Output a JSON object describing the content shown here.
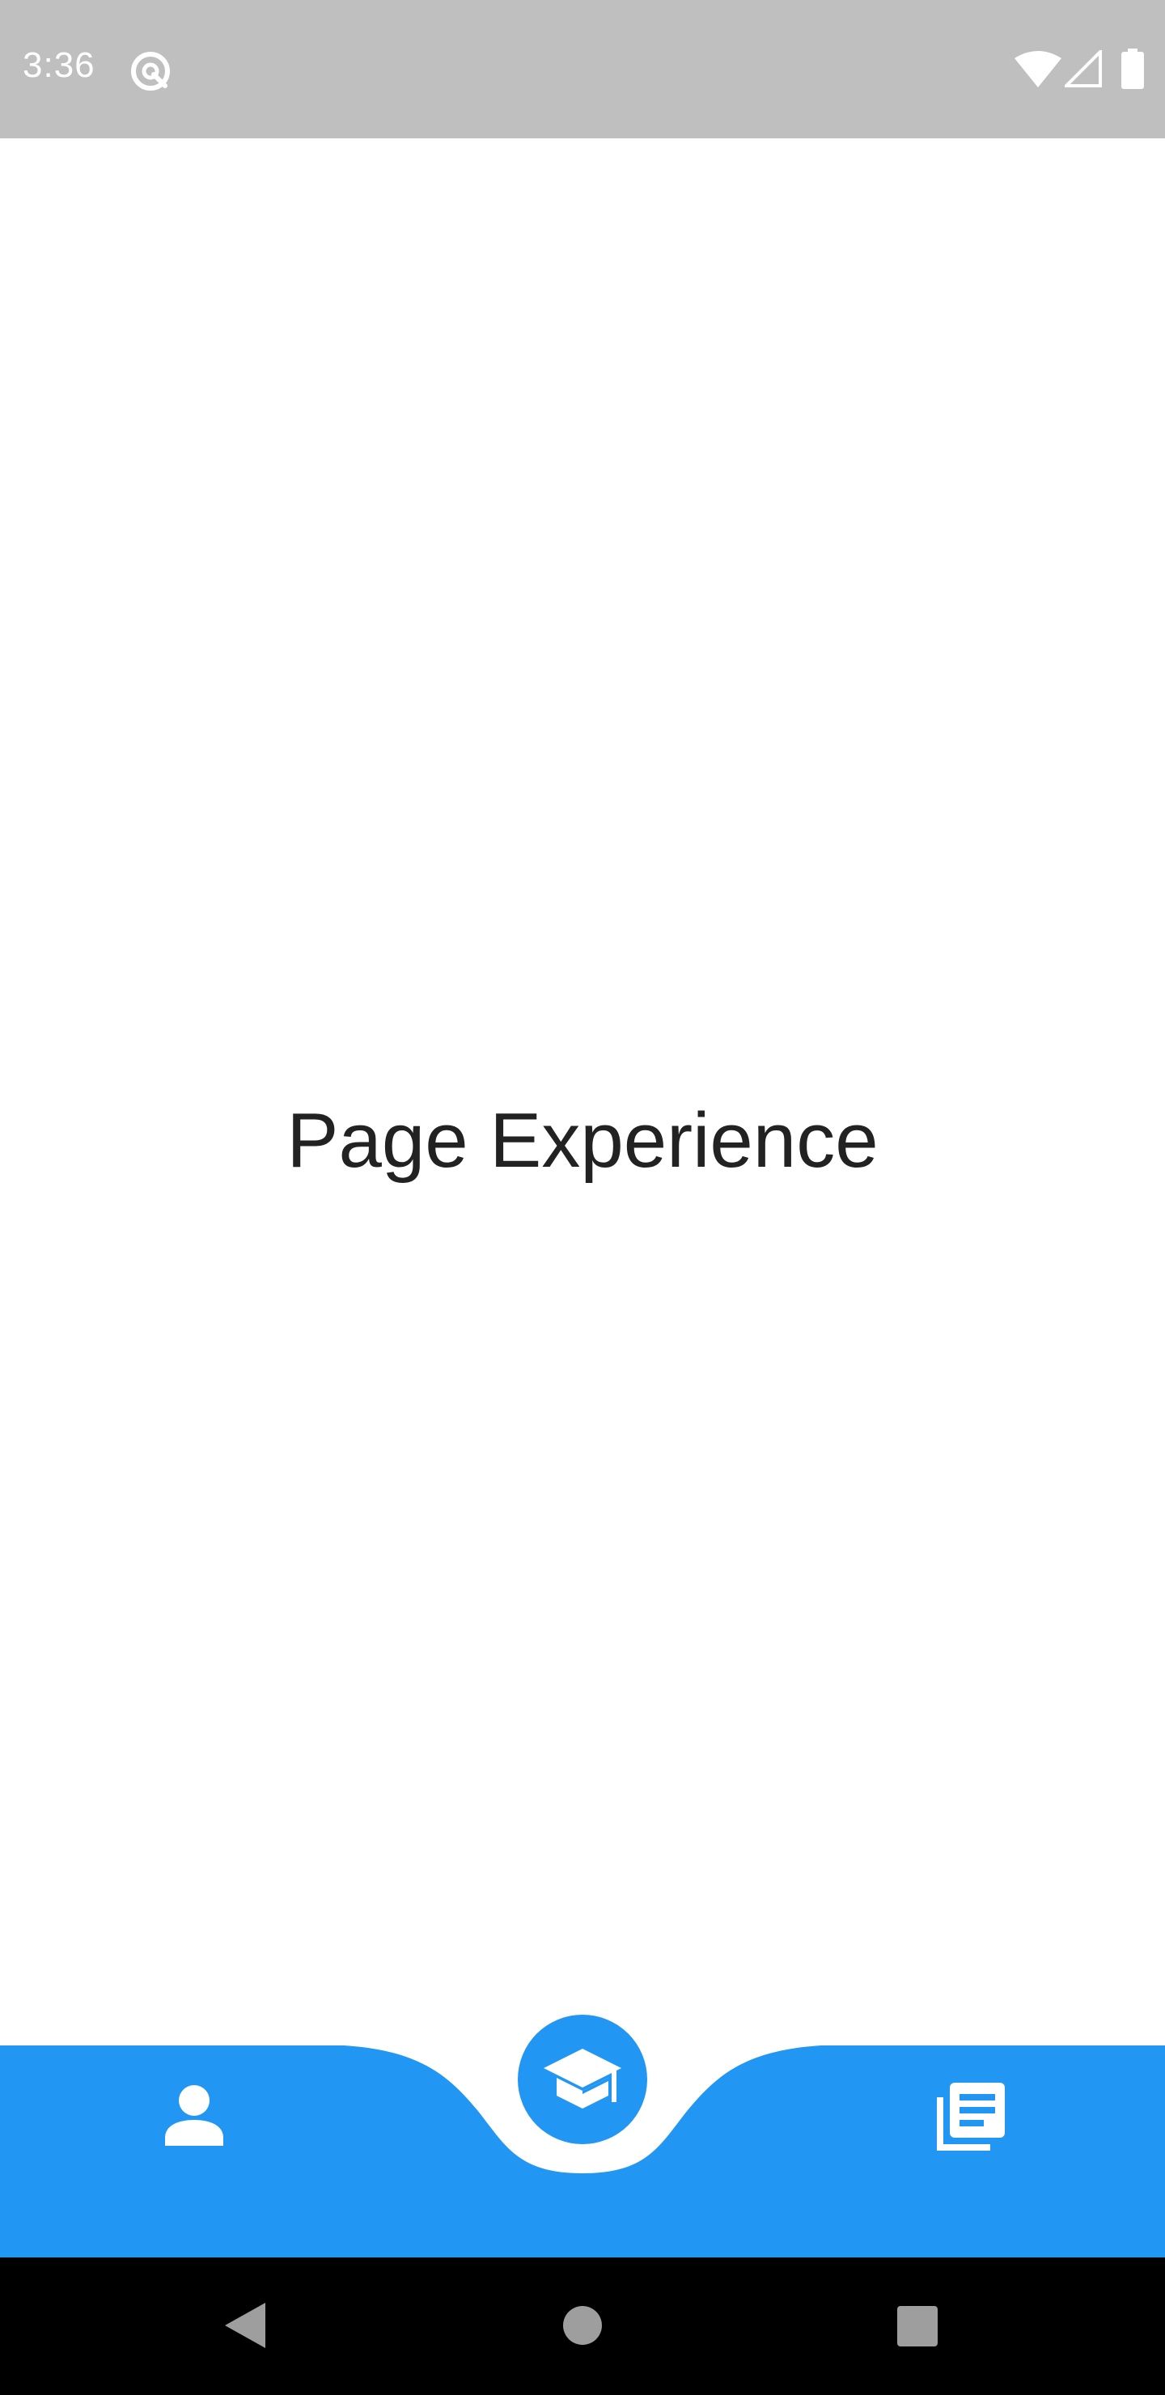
{
  "status_bar": {
    "time": "3:36",
    "icons": [
      "app-notification-icon",
      "wifi-icon",
      "cell-signal-icon",
      "battery-icon"
    ]
  },
  "main": {
    "title": "Page Experience"
  },
  "bottom_nav": {
    "accent_color": "#2196f3",
    "items": [
      {
        "icon": "person-icon"
      },
      {
        "icon": "graduation-cap-icon",
        "selected": true
      },
      {
        "icon": "newspaper-icon"
      }
    ]
  },
  "system_nav": {
    "buttons": [
      "back-icon",
      "home-icon",
      "recents-icon"
    ]
  }
}
